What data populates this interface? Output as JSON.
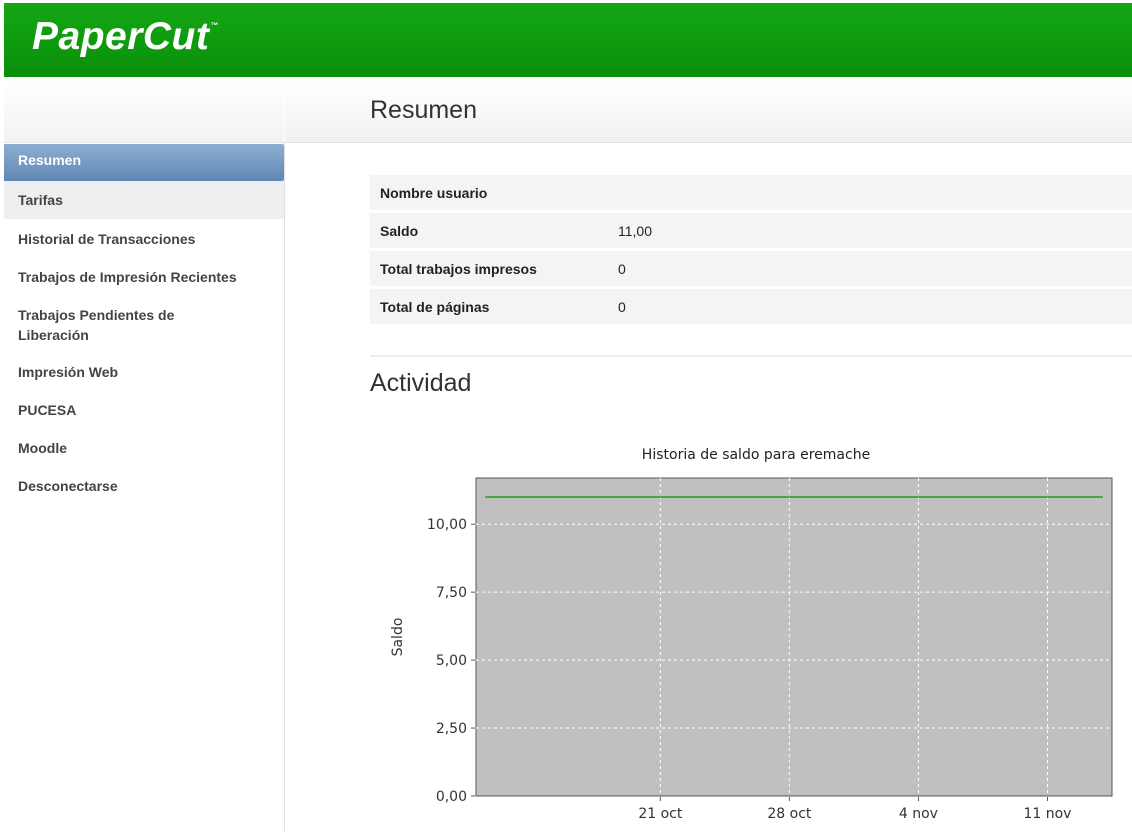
{
  "header": {
    "logo_text": "PaperCut",
    "logo_tm": "™",
    "brand_color": "#0f9f0f"
  },
  "page": {
    "title": "Resumen"
  },
  "sidebar": {
    "items": [
      {
        "label": "Resumen",
        "active": true
      },
      {
        "label": "Tarifas"
      },
      {
        "label": "Historial de Transacciones"
      },
      {
        "label": "Trabajos de Impresión Recientes"
      },
      {
        "label": "Trabajos Pendientes de Liberación"
      },
      {
        "label": "Impresión Web"
      },
      {
        "label": "PUCESA"
      },
      {
        "label": "Moodle"
      },
      {
        "label": "Desconectarse"
      }
    ],
    "active_color": "#6f93bd"
  },
  "summary": {
    "rows": [
      {
        "key": "Nombre usuario",
        "value": ""
      },
      {
        "key": "Saldo",
        "value": "11,00"
      },
      {
        "key": "Total trabajos impresos",
        "value": "0"
      },
      {
        "key": "Total de páginas",
        "value": "0"
      }
    ]
  },
  "activity": {
    "title": "Actividad"
  },
  "chart_data": {
    "type": "line",
    "title": "Historia de saldo para eremache",
    "ylabel": "Saldo",
    "xlabel": "",
    "ylim": [
      0,
      11.7
    ],
    "yticks": [
      "0,00",
      "2,50",
      "5,00",
      "7,50",
      "10,00"
    ],
    "ytick_values": [
      0,
      2.5,
      5,
      7.5,
      10
    ],
    "xticks": [
      "21 oct",
      "28 oct",
      "4 nov",
      "11 nov"
    ],
    "xtick_days": [
      21,
      28,
      35,
      42
    ],
    "x_start_day": 11,
    "x_end_day": 45.5,
    "grid": true,
    "plot_bg": "#c0c0c0",
    "series": [
      {
        "color": "#1aa01a",
        "x_days": [
          11.5,
          45
        ],
        "values": [
          11,
          11
        ]
      }
    ]
  }
}
